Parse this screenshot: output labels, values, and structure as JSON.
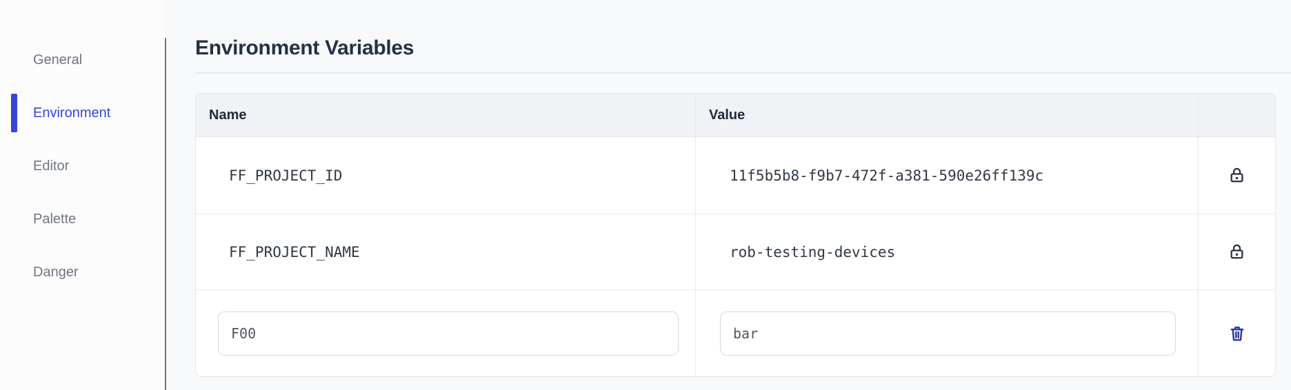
{
  "sidebar": {
    "items": [
      {
        "label": "General",
        "active": false
      },
      {
        "label": "Environment",
        "active": true
      },
      {
        "label": "Editor",
        "active": false
      },
      {
        "label": "Palette",
        "active": false
      },
      {
        "label": "Danger",
        "active": false
      }
    ]
  },
  "main": {
    "title": "Environment Variables",
    "table": {
      "columns": {
        "name": "Name",
        "value": "Value",
        "actions": ""
      },
      "rows": [
        {
          "name": "FF_PROJECT_ID",
          "value": "11f5b5b8-f9b7-472f-a381-590e26ff139c",
          "locked": true,
          "action_icon": "lock-icon"
        },
        {
          "name": "FF_PROJECT_NAME",
          "value": "rob-testing-devices",
          "locked": true,
          "action_icon": "lock-icon"
        }
      ],
      "editable_row": {
        "name_input_value": "F00",
        "value_input_value": "bar",
        "action_icon": "trash-icon"
      }
    }
  },
  "colors": {
    "accent_blue": "#3445D8",
    "trash_blue": "#2C3A9D",
    "icon_dark": "#252E3F",
    "heading_text": "#253043",
    "table_header_bg": "#F1F2F5",
    "page_bg": "#F8F9FB"
  }
}
